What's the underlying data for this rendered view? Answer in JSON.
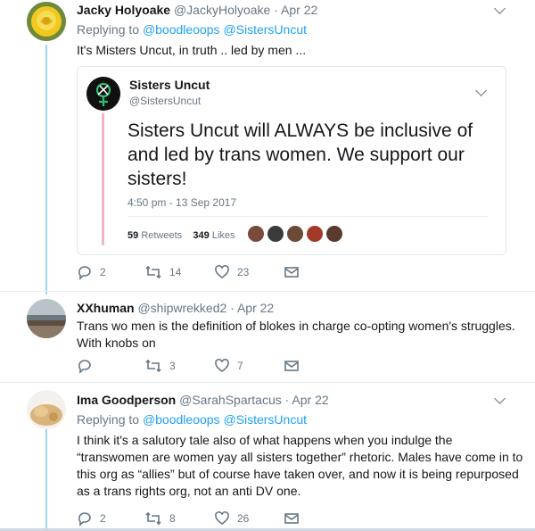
{
  "tweets": [
    {
      "name": "Jacky Holyoake",
      "handle": "@JackyHolyoake",
      "sep": "·",
      "date": "Apr 22",
      "replying_prefix": "Replying to",
      "replying_mentions": "@boodleoops @SistersUncut",
      "text": "It's Misters Uncut, in truth .. led by men ...",
      "avatar_icon": "yellow-rose-avatar",
      "actions": {
        "reply": "2",
        "retweet": "14",
        "like": "23"
      }
    },
    {
      "name": "XXhuman",
      "handle": "@shipwrekked2",
      "sep": "·",
      "date": "Apr 22",
      "text_lines": [
        "Trans wo men is the definition of blokes in charge co-opting women's struggles.",
        "With knobs on"
      ],
      "avatar_icon": "beach-photo-avatar",
      "actions": {
        "reply": "",
        "retweet": "3",
        "like": "7"
      }
    },
    {
      "name": "Ima Goodperson",
      "handle": "@SarahSpartacus",
      "sep": "·",
      "date": "Apr 22",
      "replying_prefix": "Replying to",
      "replying_mentions": "@boodleoops @SistersUncut",
      "text_lines": [
        "I think it's a salutory tale also of what happens when you indulge the",
        "“transwomen are women yay all sisters together” rhetoric. Males have come in to",
        "this org as “allies” but of course have taken over, and now it is being repurposed",
        "as a trans rights org, not an anti DV one."
      ],
      "avatar_icon": "cat-photo-avatar",
      "actions": {
        "reply": "2",
        "retweet": "8",
        "like": "26"
      }
    }
  ],
  "quoted": {
    "name": "Sisters Uncut",
    "handle": "@SistersUncut",
    "text_lines": [
      "Sisters Uncut will ALWAYS be inclusive of",
      "and led by trans women. We support our",
      "sisters!"
    ],
    "timestamp": "4:50 pm - 13 Sep 2017",
    "retweets_count": "59",
    "retweets_label": "Retweets",
    "likes_count": "349",
    "likes_label": "Likes",
    "avatar_icon": "sisters-uncut-logo",
    "liker_colors": [
      "#7a4a3a",
      "#3b3b3b",
      "#6b4b35",
      "#a23a2a",
      "#5a3a2e"
    ]
  },
  "colors": {
    "accent": "#1da1f2",
    "thread": "#9fd4f2",
    "muted": "#657786"
  }
}
